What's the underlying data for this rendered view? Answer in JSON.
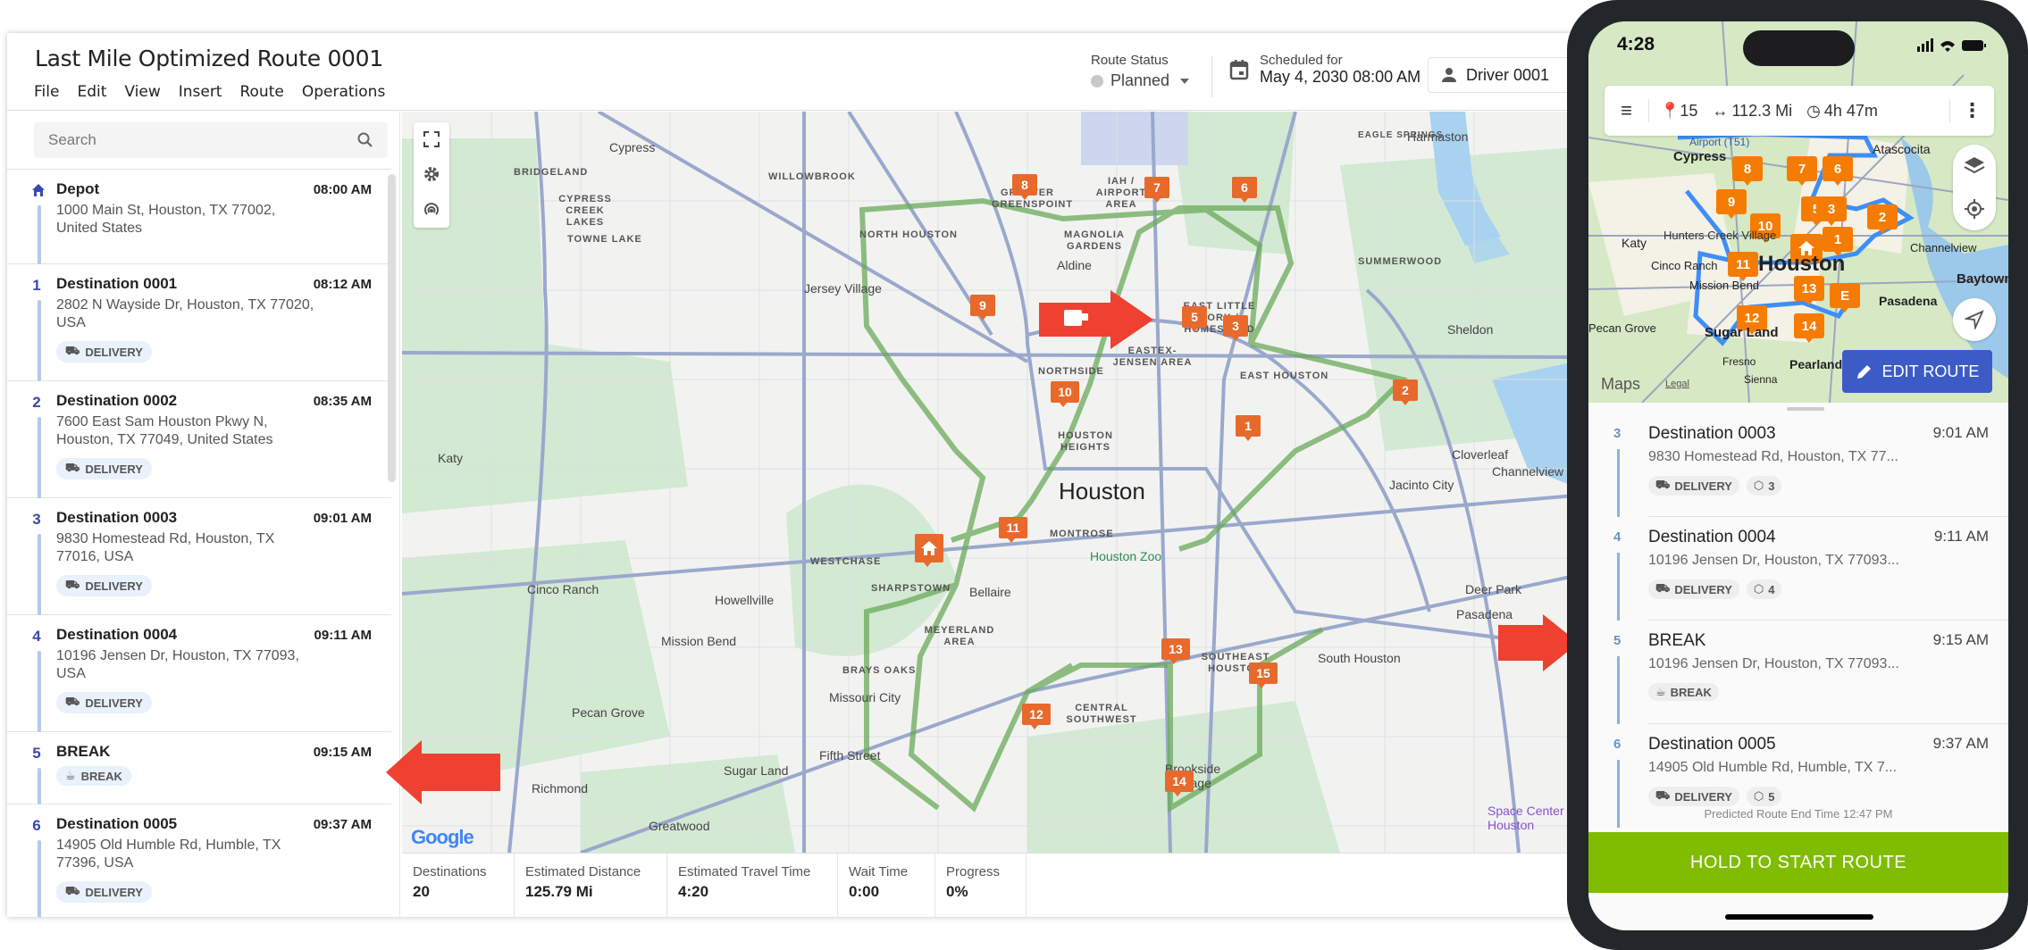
{
  "app": {
    "title": "Last Mile Optimized Route 0001",
    "menu": [
      "File",
      "Edit",
      "View",
      "Insert",
      "Route",
      "Operations"
    ],
    "route_status": {
      "label": "Route Status",
      "value": "Planned"
    },
    "schedule": {
      "label": "Scheduled for",
      "value": "May 4, 2030 08:00 AM"
    },
    "driver": "Driver 0001"
  },
  "sidebar": {
    "search_placeholder": "Search",
    "stops": [
      {
        "num": "",
        "icon": "home-icon",
        "name": "Depot",
        "time": "08:00 AM",
        "address": "1000 Main St, Houston, TX 77002, United States",
        "tag": ""
      },
      {
        "num": "1",
        "name": "Destination 0001",
        "time": "08:12 AM",
        "address": "2802 N Wayside Dr, Houston, TX 77020, USA",
        "tag": "DELIVERY"
      },
      {
        "num": "2",
        "name": "Destination 0002",
        "time": "08:35 AM",
        "address": "7600 East Sam Houston Pkwy N, Houston, TX 77049, United States",
        "tag": "DELIVERY"
      },
      {
        "num": "3",
        "name": "Destination 0003",
        "time": "09:01 AM",
        "address": "9830 Homestead Rd, Houston, TX 77016, USA",
        "tag": "DELIVERY"
      },
      {
        "num": "4",
        "name": "Destination 0004",
        "time": "09:11 AM",
        "address": "10196 Jensen Dr, Houston, TX 77093, USA",
        "tag": "DELIVERY"
      },
      {
        "num": "5",
        "name": "BREAK",
        "time": "09:15 AM",
        "address": "",
        "tag": "BREAK"
      },
      {
        "num": "6",
        "name": "Destination 0005",
        "time": "09:37 AM",
        "address": "14905 Old Humble Rd, Humble, TX 77396, USA",
        "tag": "DELIVERY"
      }
    ]
  },
  "map": {
    "markers": [
      "1",
      "2",
      "3",
      "5",
      "6",
      "7",
      "8",
      "9",
      "10",
      "11",
      "12",
      "13",
      "14",
      "15"
    ],
    "labels": [
      "Cypress",
      "Jersey Village",
      "Houston",
      "Aldine",
      "Houston Zoo",
      "Bellaire",
      "Pasadena",
      "Sugar Land",
      "Missouri City",
      "Katy",
      "Cloverleaf",
      "Channelview",
      "Sheldon",
      "Deer Park",
      "Harmaston",
      "Pecan Grove",
      "Richmond",
      "Mission Bend",
      "Jacinto City",
      "Brookside Village",
      "South Houston",
      "Cinco Ranch",
      "Greatwood",
      "Howellville",
      "Fifth Street",
      "Space Center Houston"
    ],
    "districts": [
      "BRIDGELAND",
      "CYPRESS CREEK LAKES",
      "TOWNE LAKE",
      "WILLOWBROOK",
      "NORTH HOUSTON",
      "IAH / AIRPORT AREA",
      "GREATER GREENSPOINT",
      "MAGNOLIA GARDENS",
      "EAST LITTLE YORK / HOMESTEAD",
      "EASTEX-JENSEN AREA",
      "EAST HOUSTON",
      "NORTHSIDE",
      "HOUSTON HEIGHTS",
      "MONTROSE",
      "SHARPSTOWN",
      "WESTCHASE",
      "BRAYS OAKS",
      "MEYERLAND AREA",
      "SOUTHEAST HOUSTON",
      "CENTRAL SOUTHWEST",
      "EAGLE SPRINGS",
      "SUMMERWOOD"
    ],
    "attribution": "Google"
  },
  "stats": [
    {
      "label": "Destinations",
      "value": "20"
    },
    {
      "label": "Estimated Distance",
      "value": "125.79 Mi"
    },
    {
      "label": "Estimated Travel Time",
      "value": "4:20"
    },
    {
      "label": "Wait Time",
      "value": "0:00"
    },
    {
      "label": "Progress",
      "value": "0%"
    }
  ],
  "phone": {
    "time": "4:28",
    "topbar": {
      "stops": "15",
      "distance": "112.3 Mi",
      "duration": "4h 47m"
    },
    "map_markers": [
      "8",
      "7",
      "6",
      "9",
      "5",
      "3",
      "2",
      "10",
      "1",
      "11",
      "13",
      "E",
      "12",
      "14"
    ],
    "map_labels": [
      "Cypress",
      "Atascocita",
      "Katy",
      "Hunters Creek Village",
      "Houston",
      "Cinco Ranch",
      "Mission Bend",
      "Channelview",
      "Baytown",
      "Pasadena",
      "Sugar Land",
      "Pecan Grove",
      "Pearland",
      "Fresno",
      "Sienna",
      "Airport (T51)"
    ],
    "maps_brand": "Maps",
    "legal": "Legal",
    "edit_route": "EDIT ROUTE",
    "stops": [
      {
        "num": "3",
        "name": "Destination 0003",
        "time": "9:01 AM",
        "address": "9830 Homestead Rd, Houston, TX 77...",
        "tag": "DELIVERY",
        "packages": "3"
      },
      {
        "num": "4",
        "name": "Destination 0004",
        "time": "9:11 AM",
        "address": "10196 Jensen Dr, Houston, TX 77093...",
        "tag": "DELIVERY",
        "packages": "4"
      },
      {
        "num": "5",
        "name": "BREAK",
        "time": "9:15 AM",
        "address": "10196 Jensen Dr, Houston, TX 77093...",
        "tag": "BREAK",
        "packages": ""
      },
      {
        "num": "6",
        "name": "Destination 0005",
        "time": "9:37 AM",
        "address": "14905 Old Humble Rd, Humble, TX 7...",
        "tag": "DELIVERY",
        "packages": "5"
      }
    ],
    "predicted_end": "Predicted Route End Time 12:47 PM",
    "start_button": "HOLD TO START ROUTE"
  },
  "colors": {
    "accent": "#3949ab",
    "marker": "#e76a2c",
    "route": "#6aaa5a",
    "start": "#80bc00",
    "edit": "#3d5bc7",
    "arrow": "#ef4130"
  }
}
